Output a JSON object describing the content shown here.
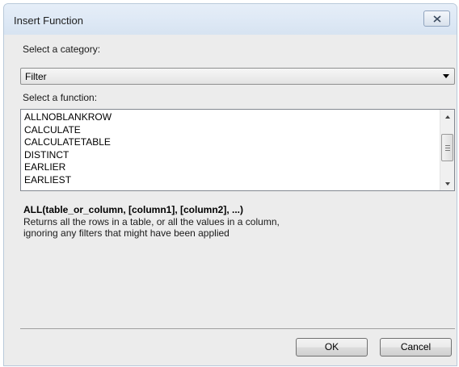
{
  "window": {
    "title": "Insert Function"
  },
  "category": {
    "label": "Select a category:",
    "selected": "Filter"
  },
  "function_list": {
    "label": "Select a function:",
    "items": [
      "ALLNOBLANKROW",
      "CALCULATE",
      "CALCULATETABLE",
      "DISTINCT",
      "EARLIER",
      "EARLIEST"
    ]
  },
  "description": {
    "signature": "ALL(table_or_column, [column1], [column2], ...)",
    "line1": "Returns all the rows in a table, or all the values in a column,",
    "line2": "ignoring any filters that might have been applied"
  },
  "buttons": {
    "ok": "OK",
    "cancel": "Cancel"
  },
  "icons": {
    "close": "close-icon",
    "dropdown": "chevron-down-icon",
    "scroll_up": "arrow-up-icon",
    "scroll_down": "arrow-down-icon"
  }
}
